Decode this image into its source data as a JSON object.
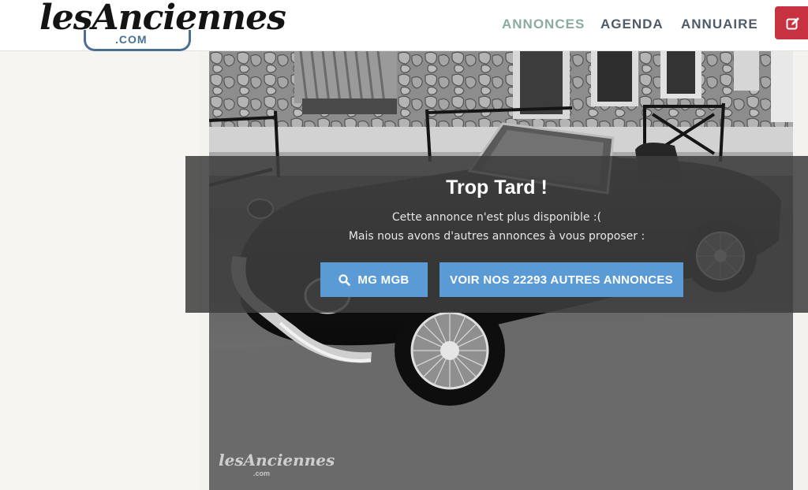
{
  "brand": {
    "logo_main": "lesAnciennes",
    "logo_sub": ".COM"
  },
  "nav": {
    "items": [
      {
        "label": "ANNONCES",
        "active": true
      },
      {
        "label": "AGENDA",
        "active": false
      },
      {
        "label": "ANNUAIRE",
        "active": false
      }
    ],
    "edit_icon": "edit-icon"
  },
  "notice": {
    "title": "Trop Tard !",
    "line1": "Cette annonce n'est plus disponible :(",
    "line2": "Mais nous avons d'autres annonces à vous proposer :",
    "search_button": "MG MGB",
    "search_icon": "search-icon",
    "all_button": "VOIR NOS 22293 AUTRES ANNONCES"
  },
  "watermark": {
    "main": "lesAnciennes",
    "sub": ".com"
  },
  "colors": {
    "accent_blue": "#5b9bd5",
    "edit_red": "#c6323f",
    "nav_active": "#8aab9f",
    "nav_text": "#4f5b6b"
  }
}
